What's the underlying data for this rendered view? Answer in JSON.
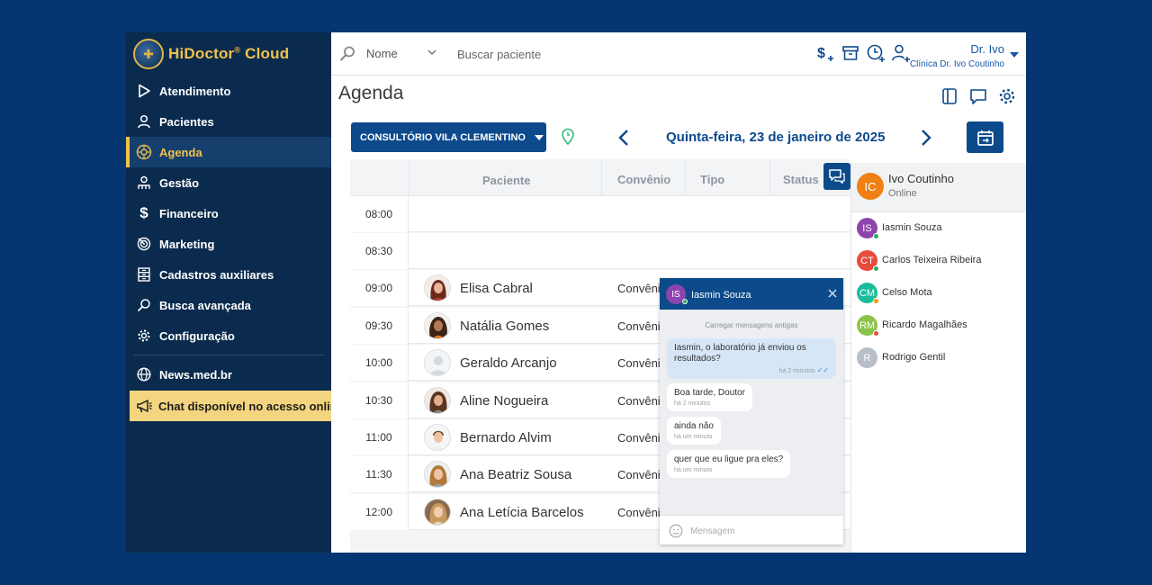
{
  "brand": {
    "name": "HiDoctor",
    "reg": "®",
    "suffix": " Cloud"
  },
  "sidebar": {
    "items": [
      {
        "label": "Atendimento",
        "icon": "play-icon"
      },
      {
        "label": "Pacientes",
        "icon": "user-icon"
      },
      {
        "label": "Agenda",
        "icon": "agenda-icon",
        "active": true
      },
      {
        "label": "Gestão",
        "icon": "management-icon"
      },
      {
        "label": "Financeiro",
        "icon": "dollar-icon"
      },
      {
        "label": "Marketing",
        "icon": "target-icon"
      },
      {
        "label": "Cadastros auxiliares",
        "icon": "cabinet-icon"
      },
      {
        "label": "Busca avançada",
        "icon": "advanced-search-icon"
      },
      {
        "label": "Configuração",
        "icon": "gear-icon"
      }
    ],
    "news": "News.med.br",
    "chat_banner": "Chat disponível no acesso online"
  },
  "topbar": {
    "search_mode": "Nome",
    "search_placeholder": "Buscar paciente",
    "user_name": "Dr. Ivo",
    "clinic": "Clínica Dr. Ivo Coutinho"
  },
  "page": {
    "title": "Agenda",
    "office": "CONSULTÓRIO VILA CLEMENTINO",
    "date": "Quinta-feira, 23 de janeiro de 2025"
  },
  "schedule": {
    "columns": [
      "Paciente",
      "Convênio",
      "Tipo",
      "Status"
    ],
    "rows": [
      {
        "time": "08:00",
        "patient": "",
        "insurance": ""
      },
      {
        "time": "08:30",
        "patient": "",
        "insurance": ""
      },
      {
        "time": "09:00",
        "patient": "Elisa Cabral",
        "insurance": "Convênio"
      },
      {
        "time": "09:30",
        "patient": "Natália Gomes",
        "insurance": "Convênio"
      },
      {
        "time": "10:00",
        "patient": "Geraldo Arcanjo",
        "insurance": "Convênio"
      },
      {
        "time": "10:30",
        "patient": "Aline Nogueira",
        "insurance": "Convênio"
      },
      {
        "time": "11:00",
        "patient": "Bernardo Alvim",
        "insurance": "Convênio"
      },
      {
        "time": "11:30",
        "patient": "Ana Beatriz Sousa",
        "insurance": "Convênio"
      },
      {
        "time": "12:00",
        "patient": "Ana Letícia Barcelos",
        "insurance": "Convênio"
      }
    ]
  },
  "contacts": {
    "me": {
      "initials": "IC",
      "name": "Ivo Coutinho",
      "status": "Online"
    },
    "list": [
      {
        "initials": "IS",
        "name": "Iasmin Souza",
        "color": "#8e44ad",
        "status_color": "#27ae60"
      },
      {
        "initials": "CT",
        "name": "Carlos Teixeira Ribeira",
        "color": "#e74c3c",
        "status_color": "#27ae60"
      },
      {
        "initials": "CM",
        "name": "Celso Mota",
        "color": "#1abc9c",
        "status_color": "#f39c12"
      },
      {
        "initials": "RM",
        "name": "Ricardo Magalhães",
        "color": "#8bc34a",
        "status_color": "#e74c3c"
      },
      {
        "initials": "R",
        "name": "Rodrigo Gentil",
        "color": "#b8bec6",
        "status_color": ""
      }
    ]
  },
  "chat": {
    "contact_initials": "IS",
    "contact_name": "Iasmin Souza",
    "load_older": "Carregar mensagens antigas",
    "messages": [
      {
        "from": "me",
        "text": "Iasmin, o laboratório já enviou os resultados?",
        "time": "há 2 minutos"
      },
      {
        "from": "them",
        "text": "Boa tarde, Doutor",
        "time": "há 2 minutos"
      },
      {
        "from": "them",
        "text": "ainda não",
        "time": "há um minuto"
      },
      {
        "from": "them",
        "text": "quer que eu ligue pra eles?",
        "time": "há um minuto"
      }
    ],
    "input_placeholder": "Mensagem"
  },
  "colors": {
    "primary": "#0c4a8c",
    "sidebar": "#0b2b4e",
    "accent": "#f1c24a",
    "background": "#053672"
  }
}
